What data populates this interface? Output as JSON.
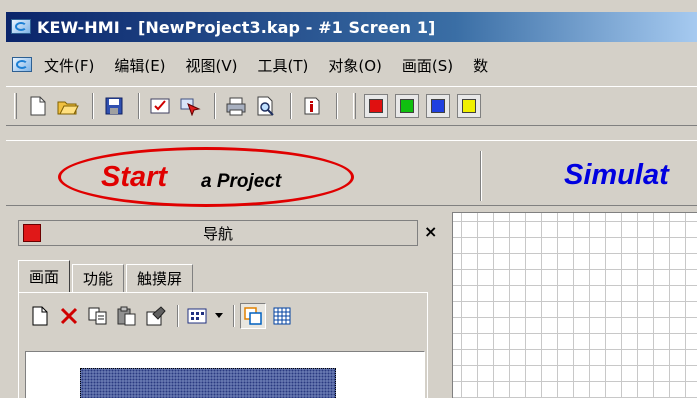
{
  "window": {
    "title": "KEW-HMI - [NewProject3.kap - #1 Screen 1]"
  },
  "menu": {
    "items": [
      {
        "label": "文件(F)"
      },
      {
        "label": "编辑(E)"
      },
      {
        "label": "视图(V)"
      },
      {
        "label": "工具(T)"
      },
      {
        "label": "对象(O)"
      },
      {
        "label": "画面(S)"
      },
      {
        "label": "数"
      }
    ]
  },
  "toolbar": {
    "icons": [
      "new-file-icon",
      "open-folder-icon",
      "save-icon",
      "check-screen-icon",
      "compile-icon",
      "print-icon",
      "print-preview-icon",
      "info-icon"
    ],
    "colors": [
      "#e01010",
      "#10c010",
      "#2040e0",
      "#f0f000"
    ]
  },
  "banner": {
    "start": "Start",
    "a_project": "a Project",
    "simulate": "Simulat"
  },
  "nav": {
    "title": "导航",
    "close": "×",
    "tabs": [
      {
        "label": "画面",
        "active": true
      },
      {
        "label": "功能",
        "active": false
      },
      {
        "label": "触摸屏",
        "active": false
      }
    ],
    "tools": [
      "new-screen-icon",
      "delete-icon",
      "copy-icon",
      "paste-icon",
      "properties-icon",
      "view-mode-icon",
      "dropdown-arrow-icon",
      "window-view-icon",
      "grid-view-icon"
    ]
  }
}
